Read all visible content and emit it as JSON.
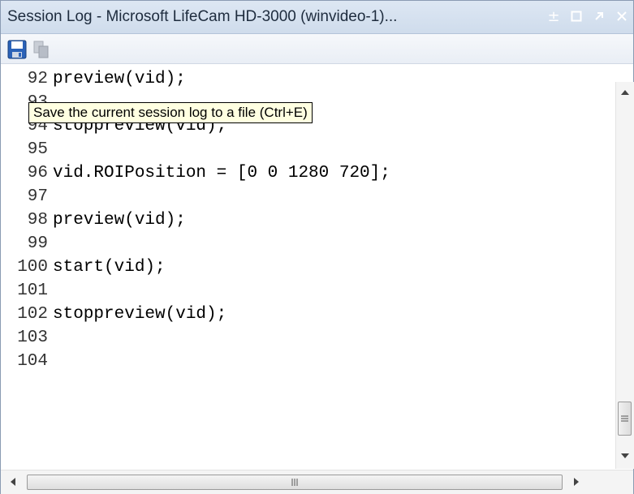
{
  "window": {
    "title": "Session Log - Microsoft LifeCam HD-3000 (winvideo-1)...",
    "controls": {
      "dock_glyph": "±"
    }
  },
  "toolbar": {
    "save_icon": "floppy-disk-icon",
    "copy_icon": "copy-icon"
  },
  "tooltip": {
    "text": "Save the current session log to a file (Ctrl+E)"
  },
  "editor": {
    "lines": [
      {
        "num": "92",
        "code": "preview(vid);"
      },
      {
        "num": "93",
        "code": ""
      },
      {
        "num": "94",
        "code": "stoppreview(vid);"
      },
      {
        "num": "95",
        "code": ""
      },
      {
        "num": "96",
        "code": "vid.ROIPosition = [0 0 1280 720];"
      },
      {
        "num": "97",
        "code": ""
      },
      {
        "num": "98",
        "code": "preview(vid);"
      },
      {
        "num": "99",
        "code": ""
      },
      {
        "num": "100",
        "code": "start(vid);"
      },
      {
        "num": "101",
        "code": ""
      },
      {
        "num": "102",
        "code": "stoppreview(vid);"
      },
      {
        "num": "103",
        "code": ""
      },
      {
        "num": "104",
        "code": ""
      }
    ]
  },
  "colors": {
    "titlebar": "#d5e1ef",
    "tooltip_bg": "#ffffe1"
  }
}
